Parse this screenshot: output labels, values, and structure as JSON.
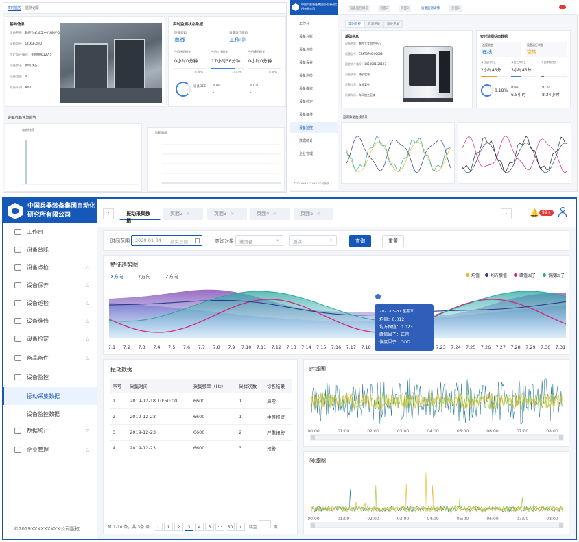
{
  "left_screen": {
    "tabs": [
      "实时监控",
      "监测记录"
    ],
    "basic_title": "基础信息",
    "basic_rows": [
      {
        "label": "设备名称：",
        "value": "数控立式加工中心HMV-0003"
      },
      {
        "label": "设备型号：",
        "value": "GIL63-ZHO"
      },
      {
        "label": "固定资产编号：",
        "value": "000000127.5"
      },
      {
        "label": "设备状态：",
        "value": "停机状态"
      },
      {
        "label": "设备位置：",
        "value": "0"
      },
      {
        "label": "所属车间：",
        "value": "A02"
      }
    ],
    "status_title": "实时监测状态数据",
    "conn_label": "连接状态",
    "conn_value": "离线",
    "run_label": "设备运行状态",
    "run_value": "工作中",
    "time_metrics": [
      {
        "label": "今日待机时长",
        "value": "0小时0分钟",
        "pct": "0.00%",
        "fill": 0
      },
      {
        "label": "今日工作时长",
        "value": "17小时38分钟",
        "pct": "73.43%",
        "fill": 73.43
      },
      {
        "label": "今日停机时长",
        "value": "0小时0分钟",
        "pct": "0.00%",
        "fill": 0
      }
    ],
    "oee_label": "设备OEE",
    "mtbf_label": "MTBF",
    "mtbf_value": "-",
    "mttr_label": "MTTR",
    "mttr_value": "-",
    "trend_title": "设备功率/电流趋势",
    "chart1_title": "电流/时间",
    "chart2_title": "功率/时间"
  },
  "right_screen": {
    "title": "中国兵器装备集团自动化研究所有限公司",
    "breadcrumbs": [
      "设备监控概览",
      "页面2",
      "页面3",
      "设备监测详情",
      "页面5"
    ],
    "subtabs": [
      "实时监控",
      "监测记录",
      "运维记录"
    ],
    "side_items": [
      "工作台",
      "设备台账",
      "设备点检",
      "设备保养",
      "设备巡检",
      "设备维修",
      "设备检定",
      "设备备件",
      "设备监控",
      "数据统计",
      "企业管理"
    ],
    "basic_title": "基础信息",
    "basic_rows": [
      {
        "label": "设备名称：",
        "value": "数控立式加工中心"
      },
      {
        "label": "设备型号：",
        "value": "CRKT6700-00008"
      },
      {
        "label": "固定资产编号：",
        "value": "1450001-20123"
      },
      {
        "label": "设备状态：",
        "value": "待机状态"
      },
      {
        "label": "设备位置：",
        "value": "车间某处"
      },
      {
        "label": "所属车间：",
        "value": "车间加工区域"
      }
    ],
    "status_title": "实时监测状态数据",
    "conn_label": "连接状态",
    "conn_value": "在线",
    "run_label": "设备运行状态",
    "run_value": "空转",
    "metrics": [
      {
        "label": "今日运行时长",
        "value": "2小时45分"
      },
      {
        "label": "今日工作时长",
        "value": "3小时45分"
      },
      {
        "label": "今日停机时长",
        "value": "-"
      }
    ],
    "oee_value": "8.18%",
    "mtbf_label": "MTBF",
    "mtbf_value": "6.5小时",
    "mttr_label": "MTTR",
    "mttr_value": "8.34小时",
    "trend_title": "监测数据曲线统计",
    "footer": "©2019XXXXXXXXX公司系统"
  },
  "app": {
    "brand": "中国兵器装备集团自动化研究所有限公司",
    "nav": [
      {
        "label": "工作台",
        "arrow": ""
      },
      {
        "label": "设备台账",
        "arrow": ""
      },
      {
        "label": "设备点检",
        "arrow": "△"
      },
      {
        "label": "设备保养",
        "arrow": "△"
      },
      {
        "label": "设备巡检",
        "arrow": "△"
      },
      {
        "label": "设备维修",
        "arrow": "△"
      },
      {
        "label": "设备检定",
        "arrow": "△"
      },
      {
        "label": "备品备件",
        "arrow": "△"
      },
      {
        "label": "设备监控",
        "arrow": ""
      },
      {
        "label": "振动采集数据",
        "arrow": ""
      },
      {
        "label": "设备监控数据",
        "arrow": ""
      },
      {
        "label": "数据统计",
        "arrow": "▽"
      },
      {
        "label": "企业管理",
        "arrow": "△"
      }
    ],
    "footer": "©2019XXXXXXXXX公司版权",
    "tabs": [
      "振动采集数据",
      "页面2",
      "页面3",
      "页面4",
      "页面5"
    ],
    "notif_badge": "99+",
    "filter": {
      "range_label": "时间范围",
      "date_from": "2020-01-04",
      "date_sep": "—",
      "date_to_placeholder": "结束日期",
      "device_label": "查询对象",
      "device_placeholder": "选设备",
      "point_placeholder": "测点",
      "query_btn": "查询",
      "reset_btn": "重置"
    },
    "feature": {
      "title": "特征趋势图",
      "dir_tabs": [
        "X方向",
        "Y方向",
        "Z方向"
      ],
      "legend": [
        {
          "name": "均值",
          "color": "#f0b429"
        },
        {
          "name": "均方根值",
          "color": "#2d3a8c"
        },
        {
          "name": "峰值因子",
          "color": "#d6287a"
        },
        {
          "name": "偏度因子",
          "color": "#2aa6a0"
        }
      ],
      "dates": [
        "7.1",
        "7.2",
        "7.3",
        "7.4",
        "7.5",
        "7.6",
        "7.7",
        "7.8",
        "7.9",
        "7.10",
        "7.11",
        "7.12",
        "7.13",
        "7.14",
        "7.15",
        "7.16",
        "7.17",
        "7.18",
        "7.19",
        "7.20",
        "7.21",
        "7.22",
        "7.23",
        "7.24",
        "7.25",
        "7.26",
        "7.27",
        "7.28",
        "7.29",
        "7.30",
        "7.31"
      ],
      "tooltip": {
        "date": "2021-05-31 星期五",
        "lines": [
          "均值：0.012",
          "均方根值：0.023",
          "峰值因子：正常",
          "偏度因子：COD"
        ]
      }
    },
    "table": {
      "title": "振动数据",
      "headers": [
        "序号",
        "采集时间",
        "采集频率（Hz）",
        "采样次数",
        "诊断结果"
      ],
      "rows": [
        [
          "1",
          "2019-12-18 10:50:00",
          "6600",
          "1",
          "异常"
        ],
        [
          "2",
          "2019-12-23",
          "6600",
          "1",
          "中等报警"
        ],
        [
          "3",
          "2019-12-23",
          "6600",
          "2",
          "严重报警"
        ],
        [
          "4",
          "2019-12-23",
          "6600",
          "3",
          "预警"
        ]
      ],
      "pager_summary": "显 1-10 条，共 3条 条",
      "pages": [
        "1",
        "2",
        "3",
        "4",
        "5",
        "···",
        "50"
      ],
      "active_page": "3",
      "goto_label": "跳至",
      "page_unit": "页"
    },
    "time_chart": {
      "title": "时域图",
      "ticks": [
        "00:00",
        "01:00",
        "02:00",
        "03:00",
        "04:00",
        "05:00",
        "06:00",
        "07:00",
        "08:00"
      ]
    },
    "freq_chart": {
      "title": "频域图",
      "ticks": [
        "00:00",
        "01:00",
        "02:00",
        "03:00",
        "04:00",
        "05:00",
        "06:00",
        "07:00",
        "08:00"
      ]
    }
  }
}
